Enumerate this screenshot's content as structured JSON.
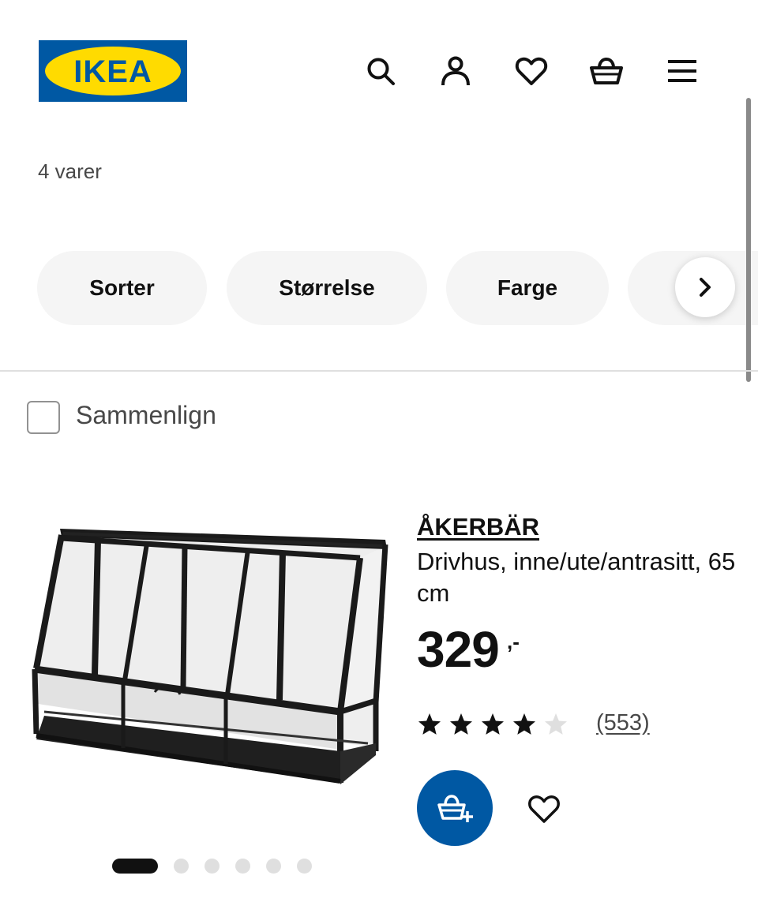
{
  "header": {
    "logo_text": "IKEA",
    "icons": [
      "search-icon",
      "profile-icon",
      "heart-icon",
      "basket-icon",
      "menu-icon"
    ],
    "brand_blue": "#0058a3",
    "brand_yellow": "#ffdb00"
  },
  "results": {
    "count_label": "4 varer"
  },
  "filters": {
    "items": [
      {
        "label": "Sorter"
      },
      {
        "label": "Størrelse"
      },
      {
        "label": "Farge"
      }
    ],
    "next_icon": "chevron-right-icon"
  },
  "compare": {
    "label": "Sammenlign",
    "checked": false
  },
  "product": {
    "name": "ÅKERBÄR",
    "description": "Drivhus, inne/ute/antrasitt, 65 cm",
    "price": "329",
    "price_suffix": ",-",
    "rating": 4,
    "rating_max": 5,
    "review_count": "(553)",
    "image_icon": "greenhouse-image",
    "carousel": {
      "total": 6,
      "active": 1
    }
  }
}
